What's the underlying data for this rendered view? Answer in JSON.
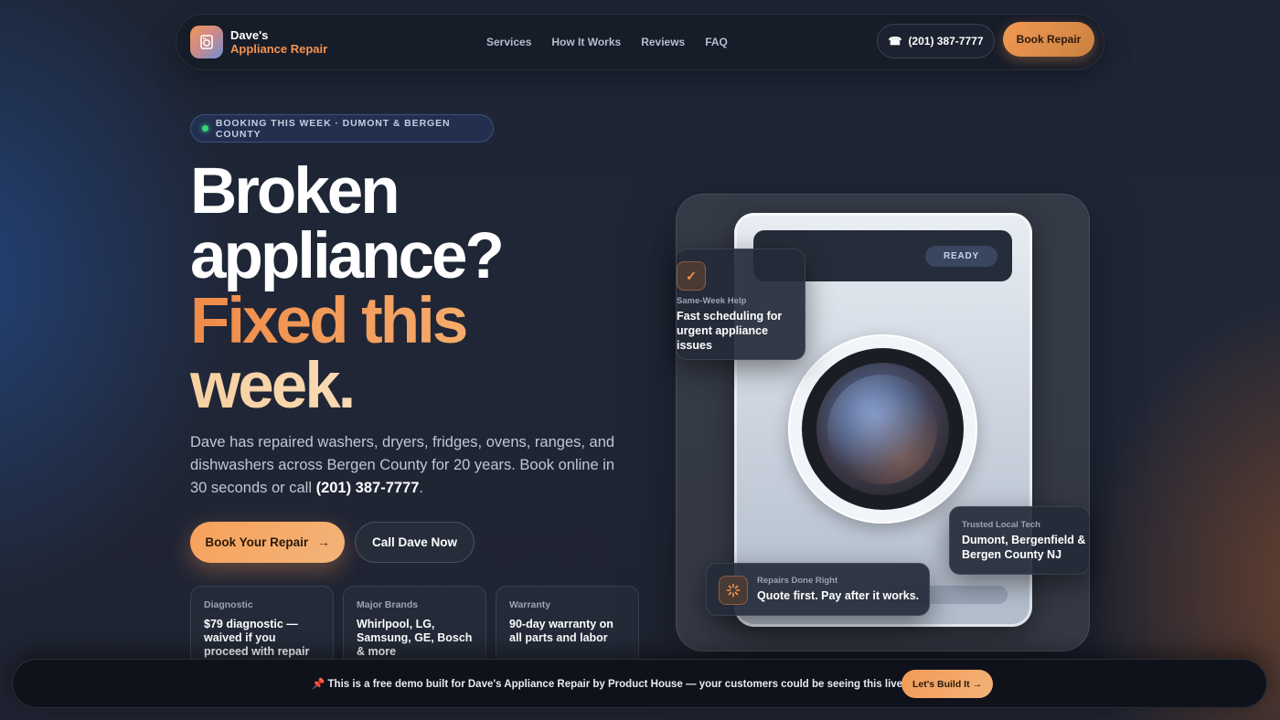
{
  "nav": {
    "brand_line1": "Dave's",
    "brand_line2": "Appliance Repair",
    "links": [
      "Services",
      "How It Works",
      "Reviews",
      "FAQ"
    ],
    "phone_icon": "☎",
    "phone": "(201) 387-7777",
    "book_label": "Book Repair"
  },
  "hero": {
    "tag": "BOOKING THIS WEEK · DUMONT & BERGEN COUNTY",
    "headline_line1": "Broken",
    "headline_line2": "appliance?",
    "headline_line3": "Fixed this",
    "headline_line4": "week.",
    "desc_text": "Dave has repaired washers, dryers, fridges, ovens, ranges, and dishwashers across Bergen County for 20 years. Book online in 30 seconds or call ",
    "desc_phone": "(201) 387-7777",
    "desc_end": ".",
    "cta_primary": "Book Your Repair",
    "cta_primary_arrow": "→",
    "cta_secondary": "Call Dave Now",
    "info_cards": [
      {
        "label": "Diagnostic",
        "body": "$79 diagnostic — waived if you proceed with repair"
      },
      {
        "label": "Major Brands",
        "body": "Whirlpool, LG, Samsung, GE, Bosch & more"
      },
      {
        "label": "Warranty",
        "body": "90-day warranty on all parts and labor"
      }
    ]
  },
  "visual": {
    "ready_label": "READY",
    "card1": {
      "icon": "✓",
      "label": "Same-Week Help",
      "body": "Fast scheduling for urgent appliance issues"
    },
    "card2": {
      "label": "Trusted Local Tech",
      "body_line1": "Dumont, Bergenfield &",
      "body_line2": "Bergen County NJ"
    },
    "card3": {
      "label": "Repairs Done Right",
      "body": "Quote first. Pay after it works."
    }
  },
  "banner": {
    "text": "📌 This is a free demo built for Dave's Appliance Repair by Product House — your customers could be seeing this live.",
    "button": "Let's Build It →"
  },
  "colors": {
    "accent_orange": "#f3944e",
    "accent_cream": "#f8d4a8",
    "status_green": "#39d27a",
    "background": "#1f2433"
  },
  "icons": {
    "logo": "washing-machine-icon",
    "phone": "phone-icon",
    "check": "check-icon",
    "spinner": "spinner-icon",
    "arrow": "arrow-right-icon"
  }
}
